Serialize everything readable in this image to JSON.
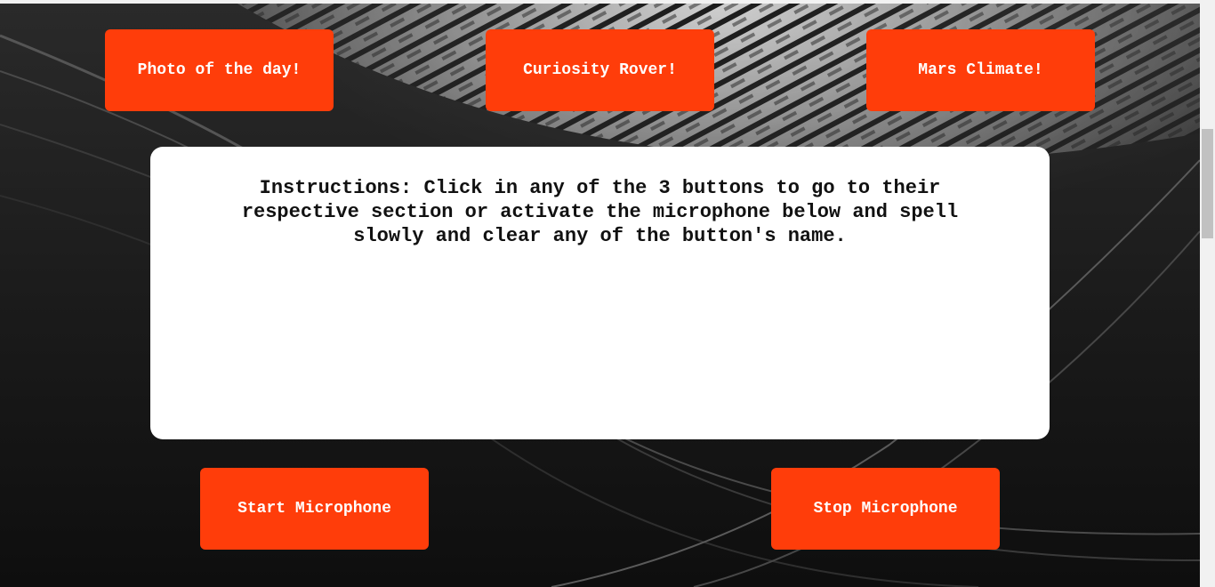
{
  "nav": {
    "photo_label": "Photo of the day!",
    "rover_label": "Curiosity Rover!",
    "climate_label": "Mars Climate!"
  },
  "instructions": {
    "text": "Instructions: Click in any of the 3 buttons to go to their respective section or activate the microphone below and spell slowly and clear any of the button's name."
  },
  "microphone": {
    "start_label": "Start Microphone",
    "stop_label": "Stop Microphone"
  },
  "colors": {
    "accent": "#ff3d0a",
    "panel": "#ffffff",
    "background": "#0b0b0b"
  }
}
